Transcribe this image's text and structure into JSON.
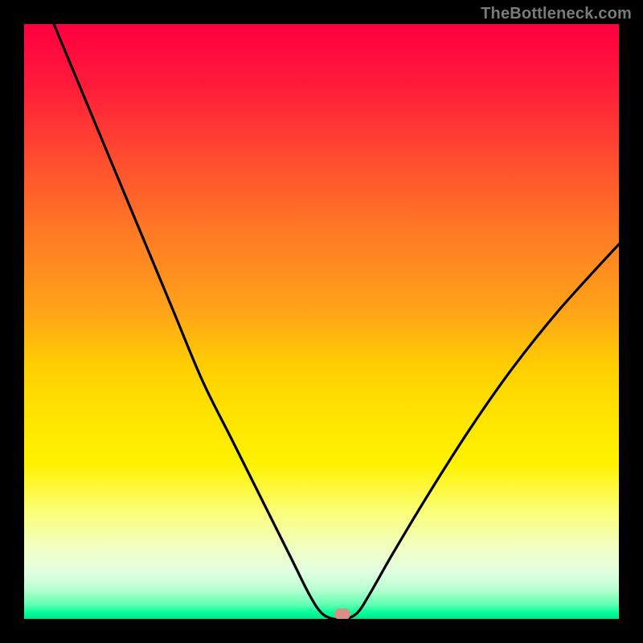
{
  "watermark": "TheBottleneck.com",
  "marker": {
    "x_pct": 53.5,
    "y_pct": 99.2,
    "color": "#d98f84"
  },
  "chart_data": {
    "type": "line",
    "title": "",
    "xlabel": "",
    "ylabel": "",
    "xlim": [
      0,
      100
    ],
    "ylim": [
      0,
      100
    ],
    "series": [
      {
        "name": "bottleneck-curve",
        "x": [
          5,
          10,
          15,
          20,
          25,
          30,
          35,
          40,
          45,
          48,
          50,
          52,
          54,
          56,
          58,
          62,
          68,
          75,
          82,
          90,
          100
        ],
        "y": [
          100,
          88,
          76,
          64,
          52,
          40,
          30,
          20,
          10,
          4,
          1,
          0,
          0,
          1,
          4,
          11,
          21,
          32,
          42,
          52,
          63
        ]
      }
    ],
    "gradient_stops": [
      {
        "pos": 0,
        "color": "#ff0040"
      },
      {
        "pos": 50,
        "color": "#ffd000"
      },
      {
        "pos": 80,
        "color": "#fbff7a"
      },
      {
        "pos": 100,
        "color": "#00e58a"
      }
    ],
    "marker_point": {
      "x": 53.5,
      "y": 0
    }
  }
}
